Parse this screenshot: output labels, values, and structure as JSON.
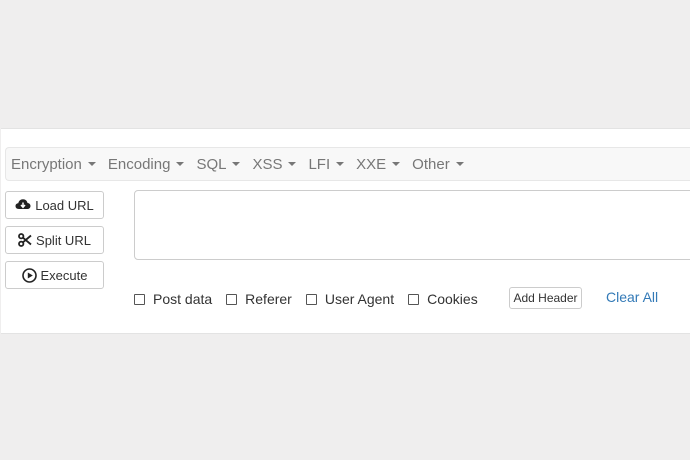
{
  "menu": {
    "items": [
      {
        "label": "Encryption",
        "icon": "caret-down-icon"
      },
      {
        "label": "Encoding",
        "icon": "caret-down-icon"
      },
      {
        "label": "SQL",
        "icon": "caret-down-icon"
      },
      {
        "label": "XSS",
        "icon": "caret-down-icon"
      },
      {
        "label": "LFI",
        "icon": "caret-down-icon"
      },
      {
        "label": "XXE",
        "icon": "caret-down-icon"
      },
      {
        "label": "Other",
        "icon": "caret-down-icon"
      }
    ]
  },
  "actions": {
    "load_url": {
      "label": "Load URL",
      "icon": "cloud-download-icon"
    },
    "split_url": {
      "label": "Split URL",
      "icon": "scissors-icon"
    },
    "execute": {
      "label": "Execute",
      "icon": "play-circle-icon"
    }
  },
  "url_input": {
    "value": ""
  },
  "options": {
    "post_data": {
      "label": "Post data",
      "checked": false
    },
    "referer": {
      "label": "Referer",
      "checked": false
    },
    "user_agent": {
      "label": "User Agent",
      "checked": false
    },
    "cookies": {
      "label": "Cookies",
      "checked": false
    }
  },
  "add_header_label": "Add Header",
  "clear_all_label": "Clear All",
  "colors": {
    "link": "#337ab7",
    "menu_text": "#777777",
    "menubar_bg": "#f8f8f8"
  }
}
